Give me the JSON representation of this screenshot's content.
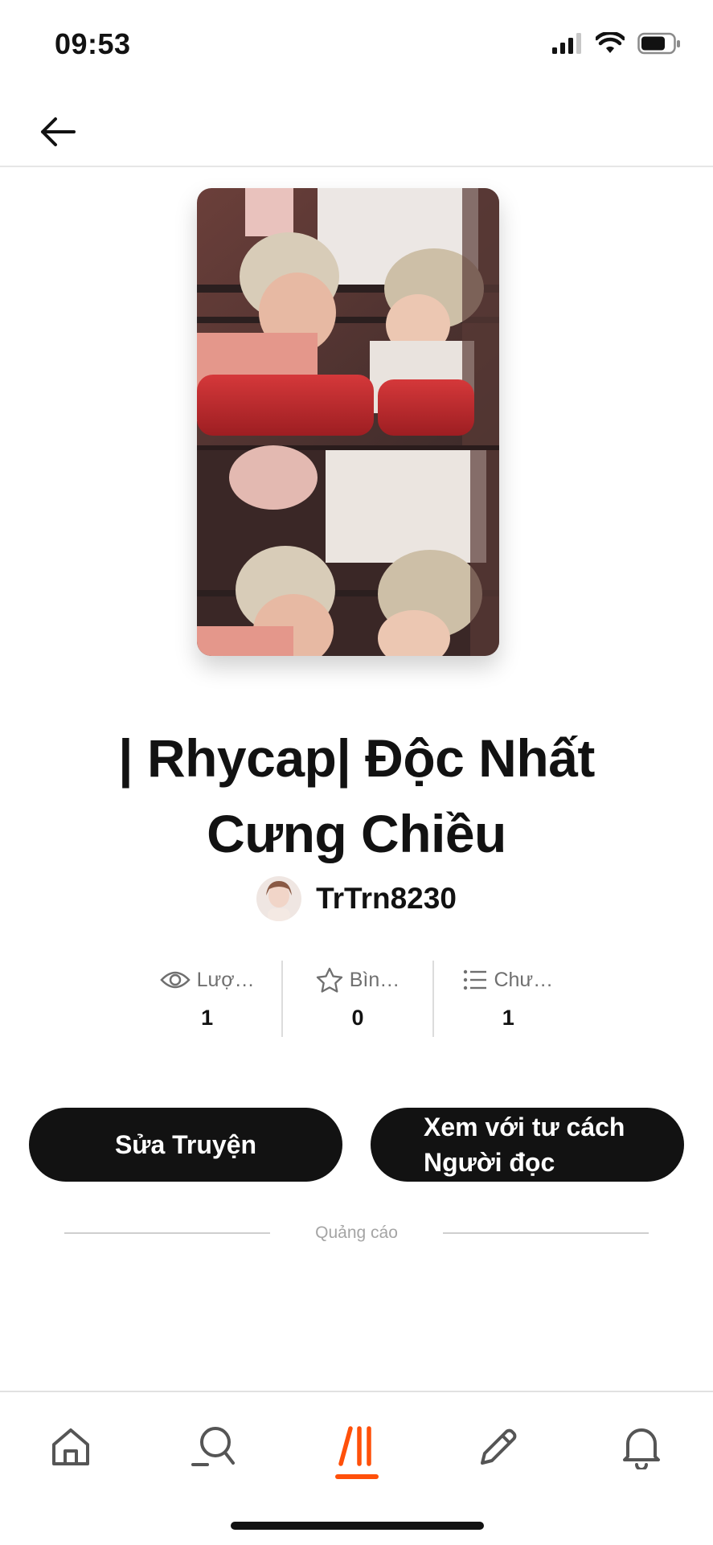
{
  "status_bar": {
    "time": "09:53"
  },
  "story": {
    "title": "| Rhycap| Độc Nhất Cưng Chiều",
    "author": "TrTrn8230"
  },
  "stats": [
    {
      "icon": "eye-icon",
      "label": "Lượ…",
      "value": "1"
    },
    {
      "icon": "star-icon",
      "label": "Bìn…",
      "value": "0"
    },
    {
      "icon": "list-icon",
      "label": "Chư…",
      "value": "1"
    }
  ],
  "buttons": {
    "edit_label": "Sửa Truyện",
    "read_label_line1": "Xem với tư cách",
    "read_label_line2": "Người đọc"
  },
  "ad_label": "Quảng cáo",
  "tabbar": {
    "items": [
      "home-icon",
      "search-icon",
      "library-icon",
      "write-icon",
      "notifications-icon"
    ],
    "active": "library-icon"
  },
  "colors": {
    "accent": "#ff500a",
    "button": "#121212"
  }
}
